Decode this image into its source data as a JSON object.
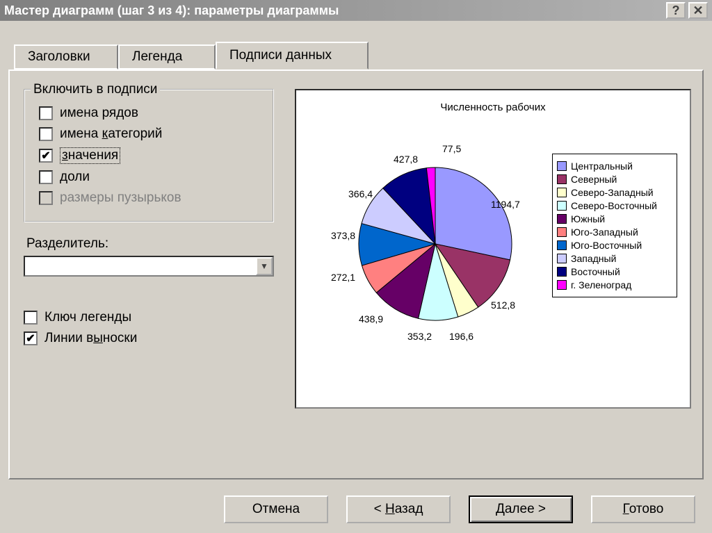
{
  "window": {
    "title": "Мастер диаграмм (шаг 3 из 4): параметры диаграммы"
  },
  "tabs": {
    "t1": "Заголовки",
    "t2": "Легенда",
    "t3": "Подписи данных"
  },
  "group": {
    "title": "Включить в подписи",
    "opt1": "имена рядов",
    "opt2_pre": "имена ",
    "opt2_u": "к",
    "opt2_post": "атегорий",
    "opt3_u": "з",
    "opt3_post": "начения",
    "opt4_u": "д",
    "opt4_post": "оли",
    "opt5": "размеры пузырьков"
  },
  "separator": {
    "label_pre": "Раз",
    "label_u": "д",
    "label_post": "елитель:"
  },
  "extra": {
    "legend_key": "Ключ легенды",
    "leader_pre": "Линии в",
    "leader_u": "ы",
    "leader_post": "носки"
  },
  "buttons": {
    "cancel": "Отмена",
    "back_pre": "< ",
    "back_u": "Н",
    "back_post": "азад",
    "next_pre": "",
    "next_u": "Д",
    "next_post": "алее >",
    "finish_u": "Г",
    "finish_post": "отово"
  },
  "chart_data": {
    "type": "pie",
    "title": "Численность рабочих",
    "series": [
      {
        "name": "Центральный",
        "value": 1194.7,
        "label": "1194,7",
        "color": "#9999ff"
      },
      {
        "name": "Северный",
        "value": 512.8,
        "label": "512,8",
        "color": "#993366"
      },
      {
        "name": "Северо-Западный",
        "value": 196.6,
        "label": "196,6",
        "color": "#ffffcc"
      },
      {
        "name": "Северо-Восточный",
        "value": 353.2,
        "label": "353,2",
        "color": "#ccffff"
      },
      {
        "name": "Южный",
        "value": 438.9,
        "label": "438,9",
        "color": "#660066"
      },
      {
        "name": "Юго-Западный",
        "value": 272.1,
        "label": "272,1",
        "color": "#ff8080"
      },
      {
        "name": "Юго-Восточный",
        "value": 373.8,
        "label": "373,8",
        "color": "#0066cc"
      },
      {
        "name": "Западный",
        "value": 366.4,
        "label": "366,4",
        "color": "#ccccff"
      },
      {
        "name": "Восточный",
        "value": 427.8,
        "label": "427,8",
        "color": "#000080"
      },
      {
        "name": "г. Зеленоград",
        "value": 77.5,
        "label": "77,5",
        "color": "#ff00ff"
      }
    ]
  }
}
